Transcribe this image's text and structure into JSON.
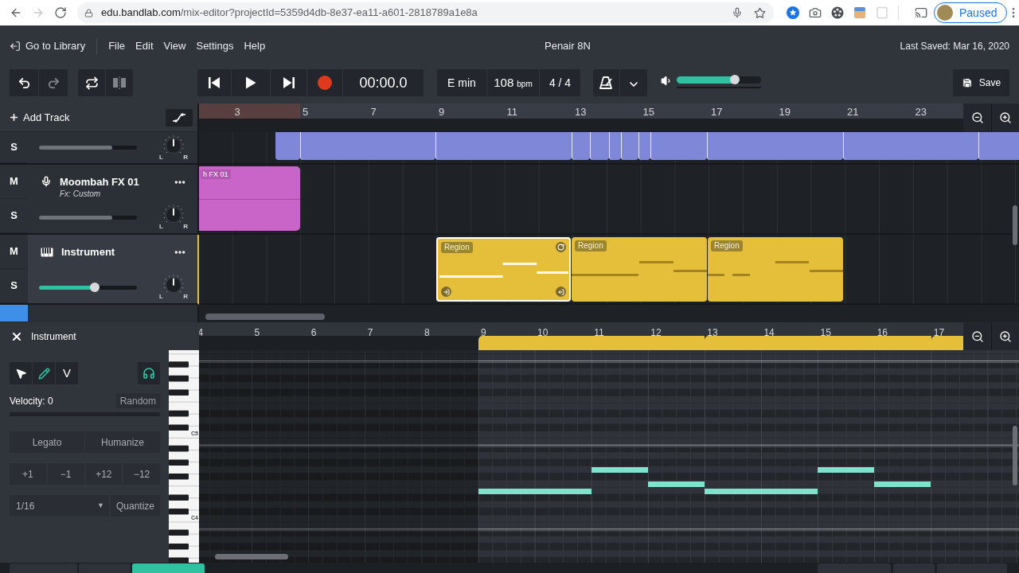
{
  "browser": {
    "url_host": "edu.bandlab.com",
    "url_path": "/mix-editor?projectId=5359d4db-8e37-ea11-a601-2818789a1e8a",
    "forward_disabled": true,
    "profile_label": "Paused"
  },
  "menu_bar": {
    "library_link": "Go to Library",
    "menus": [
      "File",
      "Edit",
      "View",
      "Settings",
      "Help"
    ],
    "project_title": "Penair 8N",
    "last_saved": "Last Saved: Mar 16, 2020"
  },
  "toolbar": {
    "redo_disabled": true,
    "split_disabled": true,
    "time": "00:00.0",
    "key": "E min",
    "tempo": "108",
    "tempo_unit": "bpm",
    "time_signature": "4 / 4",
    "master_volume": {
      "level": 0.69
    },
    "save_label": "Save"
  },
  "arrange": {
    "add_track_label": "Add Track",
    "ruler": [
      "3",
      "5",
      "7",
      "9",
      "11",
      "13",
      "15",
      "17",
      "19",
      "21",
      "23"
    ]
  },
  "tracks": [
    {
      "kind": "cut_top",
      "color": "#7f87d9",
      "selected": false,
      "solo_label": "S",
      "soloed": false,
      "volume": {
        "level": 0.75
      },
      "pan": {
        "left": "L",
        "right": "R"
      }
    },
    {
      "kind": "audio",
      "name": "Moombah FX 01",
      "fx": "Fx: Custom",
      "color": "#c964c8",
      "selected": false,
      "mute_label": "M",
      "muted": false,
      "solo_label": "S",
      "soloed": false,
      "volume": {
        "level": 0.75
      },
      "pan": {
        "left": "L",
        "right": "R"
      },
      "clips": [
        {
          "label": "h FX 01",
          "selected": false
        }
      ]
    },
    {
      "kind": "instrument",
      "name": "Instrument",
      "color": "#e5bf3a",
      "selected": true,
      "mute_label": "M",
      "muted": false,
      "solo_label": "S",
      "soloed": false,
      "volume": {
        "level": 0.57
      },
      "pan": {
        "left": "L",
        "right": "R"
      },
      "clips": [
        {
          "label": "Region",
          "selected": true
        },
        {
          "label": "Region",
          "selected": false
        },
        {
          "label": "Region",
          "selected": false
        }
      ]
    },
    {
      "kind": "cut_bottom",
      "selected": false,
      "muted": true
    }
  ],
  "editor": {
    "title": "Instrument",
    "tools": [
      {
        "kind": "pointer",
        "selected": false
      },
      {
        "kind": "pencil",
        "selected": true
      },
      {
        "kind": "velocity",
        "label": "V",
        "selected": false
      }
    ],
    "preview_on": true,
    "velocity_label": "Velocity: 0",
    "velocity": {
      "level": 0
    },
    "random_label": "Random",
    "note_actions": [
      "Legato",
      "Humanize"
    ],
    "transpose": [
      "+1",
      "−1",
      "+12",
      "−12"
    ],
    "grid_value": "1/16",
    "grid_caret": "▼",
    "quantize_label": "Quantize",
    "ruler": [
      "4",
      "5",
      "6",
      "7",
      "8",
      "9",
      "10",
      "11",
      "12",
      "13",
      "14",
      "15",
      "16",
      "17"
    ],
    "key_labels": [
      "C5",
      "C4"
    ],
    "tabs": [
      {
        "selected": false
      },
      {
        "selected": false
      },
      {
        "selected": true
      }
    ]
  }
}
